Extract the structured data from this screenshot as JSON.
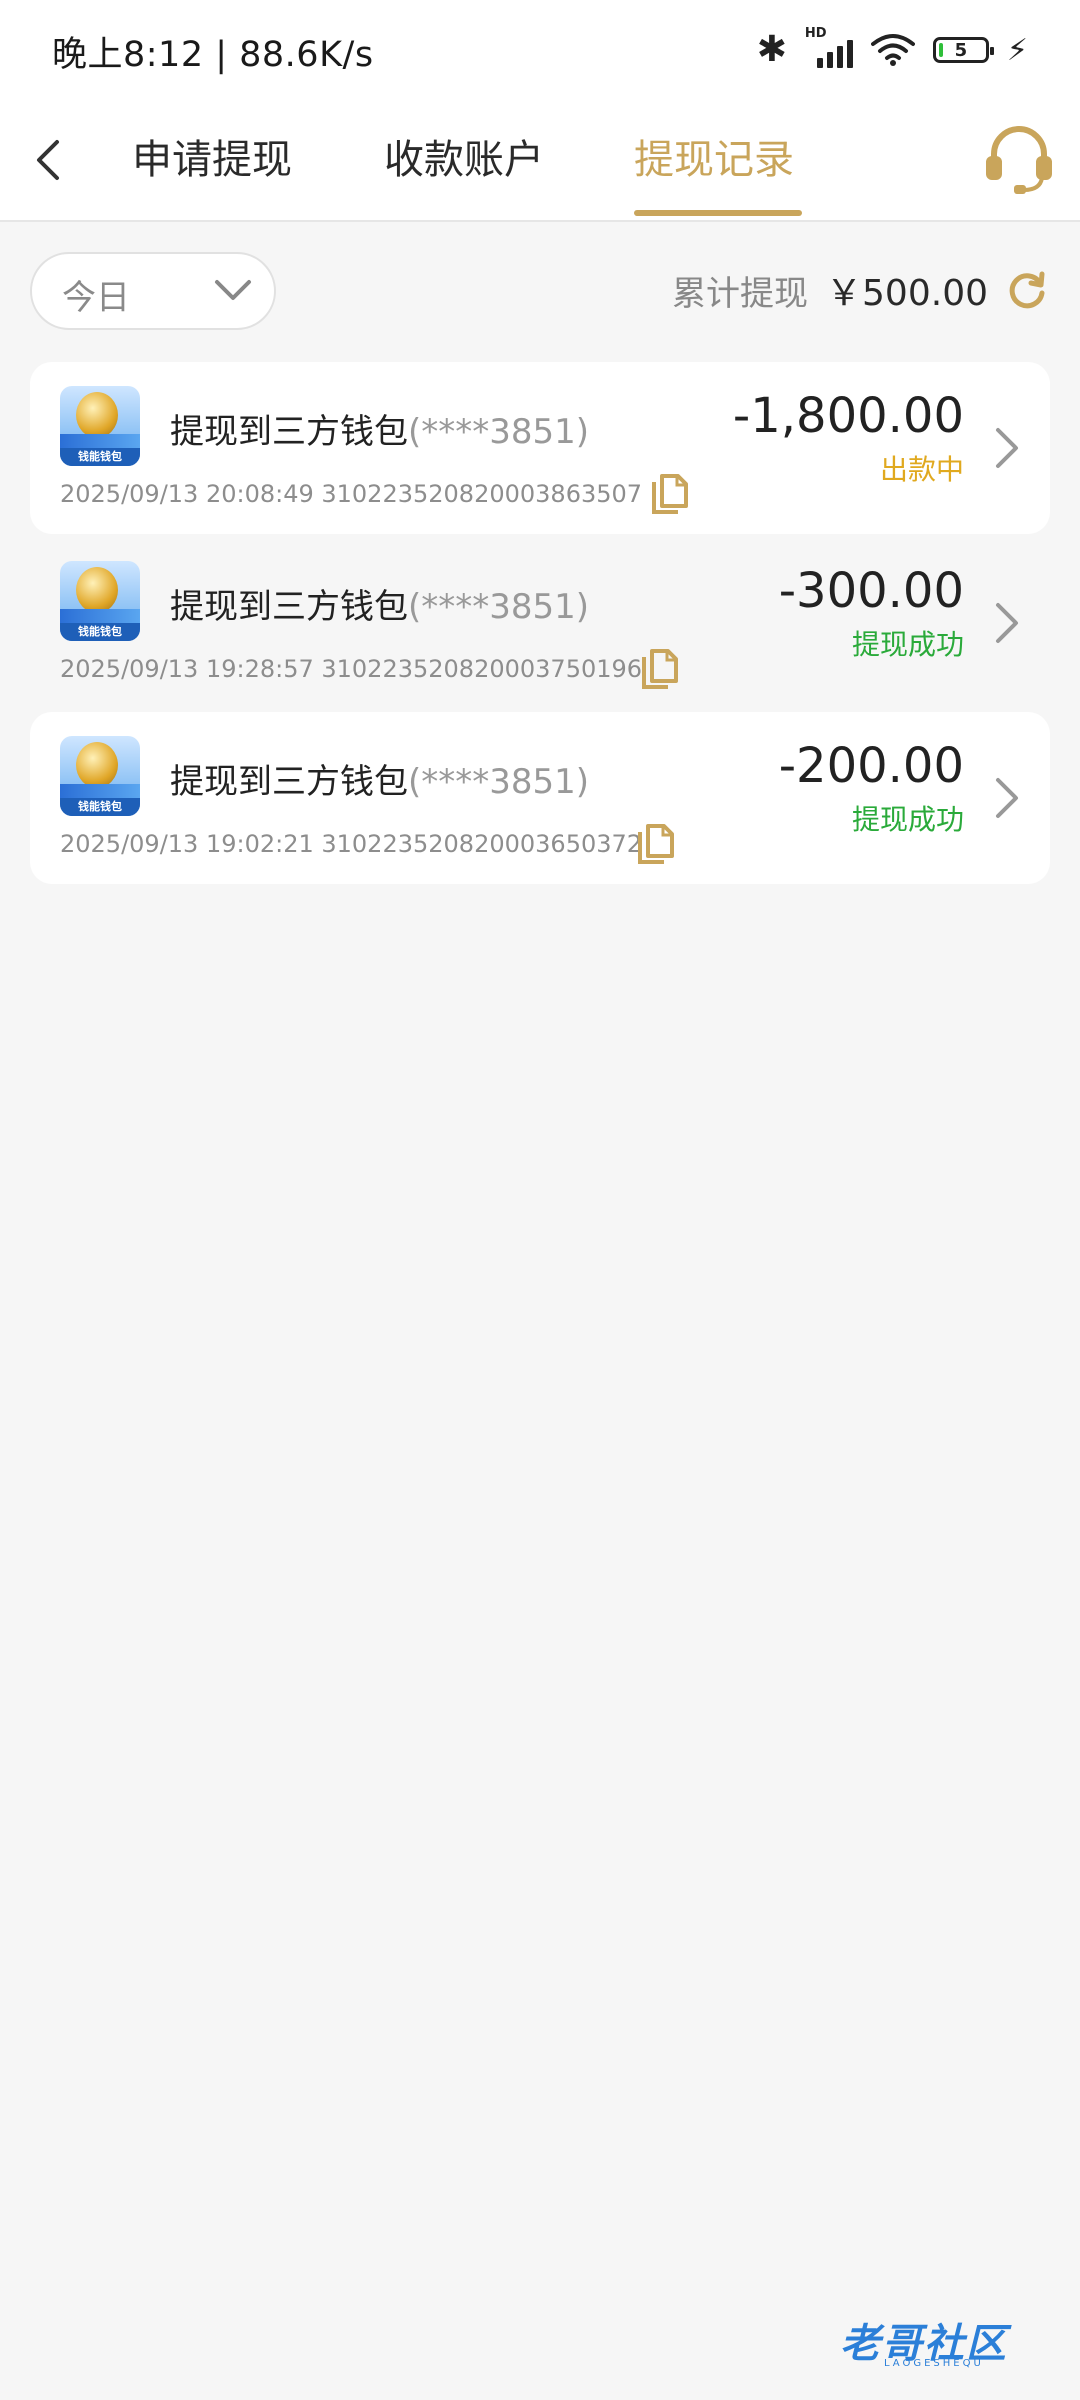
{
  "status_bar": {
    "time_speed": "晚上8:12 | 88.6K/s",
    "hd": "HD",
    "battery": "5"
  },
  "header": {
    "tabs": [
      {
        "label": "申请提现"
      },
      {
        "label": "收款账户"
      },
      {
        "label": "提现记录"
      }
    ]
  },
  "filter": {
    "date_label": "今日",
    "total_label": "累计提现",
    "total_amount": "￥500.00"
  },
  "records": [
    {
      "title": "提现到三方钱包",
      "account": "(****3851)",
      "meta": "2025/09/13 20:08:49 310223520820003863507",
      "amount": "-1,800.00",
      "status": "出款中",
      "status_color": "#e0a91f",
      "brand": "钱能钱包"
    },
    {
      "title": "提现到三方钱包",
      "account": "(****3851)",
      "meta": "2025/09/13 19:28:57 310223520820003750196",
      "amount": "-300.00",
      "status": "提现成功",
      "status_color": "#2aaa3a",
      "brand": "钱能钱包"
    },
    {
      "title": "提现到三方钱包",
      "account": "(****3851)",
      "meta": "2025/09/13 19:02:21 310223520820003650372",
      "amount": "-200.00",
      "status": "提现成功",
      "status_color": "#2aaa3a",
      "brand": "钱能钱包"
    }
  ],
  "watermark": {
    "text": "老哥社区",
    "sub": "LAOGESHEQU"
  },
  "icons": {
    "back": "chevron-left-icon",
    "support": "headset-icon",
    "dropdown": "chevron-down-icon",
    "refresh": "refresh-icon",
    "copy": "copy-icon",
    "row_arrow": "chevron-right-icon"
  },
  "colors": {
    "accent": "#c9a55b",
    "processing": "#e0a91f",
    "success": "#2aaa3a"
  }
}
